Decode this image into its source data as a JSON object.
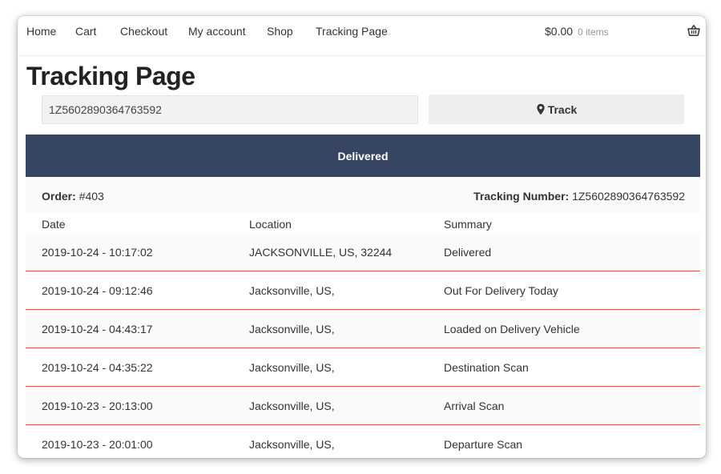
{
  "nav": {
    "links": [
      "Home",
      "Cart",
      "Checkout",
      "My account",
      "Shop",
      "Tracking Page"
    ],
    "cart_total": "$0.00",
    "cart_count": "0 items"
  },
  "page": {
    "title": "Tracking Page"
  },
  "search": {
    "value": "1Z5602890364763592",
    "button_label": "Track"
  },
  "status": "Delivered",
  "order": {
    "order_label": "Order:",
    "order_value": "#403",
    "tracking_label": "Tracking Number:",
    "tracking_value": "1Z5602890364763592"
  },
  "table": {
    "headers": [
      "Date",
      "Location",
      "Summary"
    ],
    "rows": [
      {
        "date": "2019-10-24 - 10:17:02",
        "location": "JACKSONVILLE, US, 32244",
        "summary": "Delivered"
      },
      {
        "date": "2019-10-24 - 09:12:46",
        "location": "Jacksonville, US,",
        "summary": "Out For Delivery Today"
      },
      {
        "date": "2019-10-24 - 04:43:17",
        "location": "Jacksonville, US,",
        "summary": "Loaded on Delivery Vehicle"
      },
      {
        "date": "2019-10-24 - 04:35:22",
        "location": "Jacksonville, US,",
        "summary": "Destination Scan"
      },
      {
        "date": "2019-10-23 - 20:13:00",
        "location": "Jacksonville, US,",
        "summary": "Arrival Scan"
      },
      {
        "date": "2019-10-23 - 20:01:00",
        "location": "Jacksonville, US,",
        "summary": "Departure Scan"
      }
    ]
  },
  "colors": {
    "banner": "#364561",
    "row_divider": "#d9534f"
  },
  "icons": {
    "track": "map-pin-icon",
    "cart": "basket-icon"
  }
}
